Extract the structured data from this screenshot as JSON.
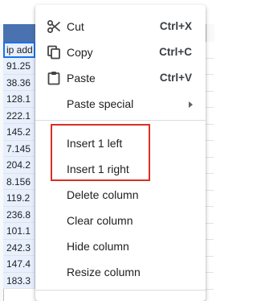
{
  "sheet": {
    "column_header_cell": "ip add",
    "cells": [
      "91.25",
      "38.36",
      "128.1",
      "222.1",
      "145.2",
      "7.145",
      "204.2",
      "8.156",
      "119.2",
      "236.8",
      "101.1",
      "242.3",
      "147.4",
      "183.3"
    ]
  },
  "menu": {
    "items": [
      {
        "label": "Cut",
        "shortcut": "Ctrl+X",
        "icon": "scissors-icon"
      },
      {
        "label": "Copy",
        "shortcut": "Ctrl+C",
        "icon": "copy-icon"
      },
      {
        "label": "Paste",
        "shortcut": "Ctrl+V",
        "icon": "clipboard-icon"
      },
      {
        "label": "Paste special",
        "icon": "submenu-arrow-icon"
      },
      {
        "label": "Insert 1 left"
      },
      {
        "label": "Insert 1 right"
      },
      {
        "label": "Delete column"
      },
      {
        "label": "Clear column"
      },
      {
        "label": "Hide column"
      },
      {
        "label": "Resize column"
      }
    ]
  },
  "colors": {
    "selection_header": "#4a72b0",
    "selection_fill": "#e8f0fe",
    "highlight_box": "#d93025"
  }
}
